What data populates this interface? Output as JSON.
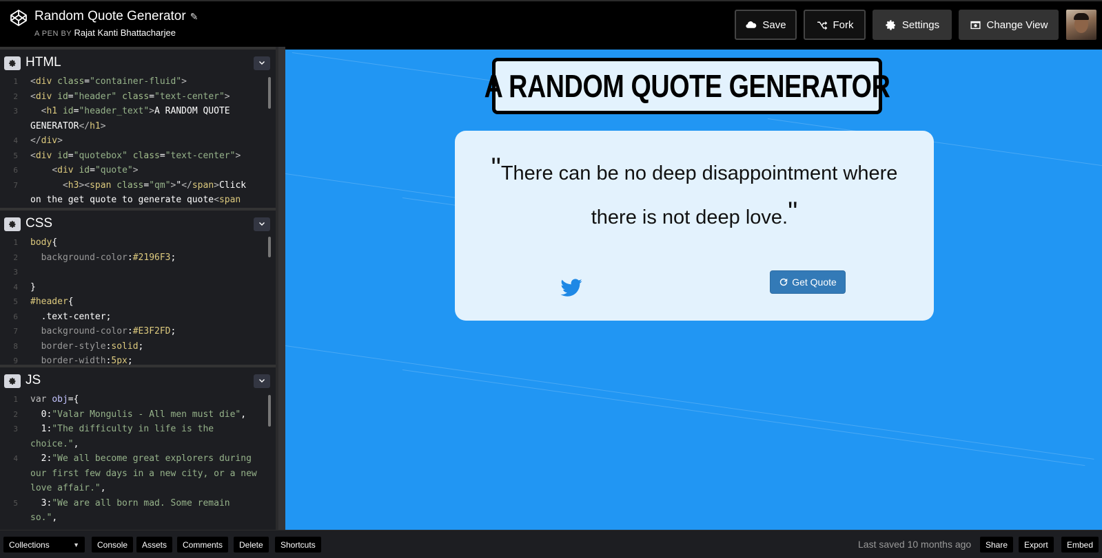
{
  "app": {
    "title": "Random Quote Generator",
    "byline_prefix": "A PEN BY",
    "author": "Rajat Kanti Bhattacharjee"
  },
  "toolbar": {
    "save": "Save",
    "fork": "Fork",
    "settings": "Settings",
    "change_view": "Change View"
  },
  "editors": {
    "html": {
      "name": "HTML",
      "lines": [
        {
          "n": "1",
          "html": "<span class='tok-fade'>&lt;</span><span class='tok-tag'>div</span> <span class='tok-attr'>class</span>=<span class='tok-str'>\"container-fluid\"</span><span class='tok-fade'>&gt;</span>"
        },
        {
          "n": "2",
          "html": "<span class='tok-fade'>&lt;</span><span class='tok-tag'>div</span> <span class='tok-attr'>id</span>=<span class='tok-str'>\"header\"</span> <span class='tok-attr'>class</span>=<span class='tok-str'>\"text-center\"</span><span class='tok-fade'>&gt;</span>"
        },
        {
          "n": "3",
          "html": "  <span class='tok-fade'>&lt;</span><span class='tok-tag'>h1</span> <span class='tok-attr'>id</span>=<span class='tok-str'>\"header_text\"</span><span class='tok-fade'>&gt;</span>A RANDOM QUOTE GENERATOR<span class='tok-fade'>&lt;/</span><span class='tok-tag'>h1</span><span class='tok-fade'>&gt;</span>"
        },
        {
          "n": "4",
          "html": "<span class='tok-fade'>&lt;/</span><span class='tok-tag'>div</span><span class='tok-fade'>&gt;</span>"
        },
        {
          "n": "5",
          "html": "<span class='tok-fade'>&lt;</span><span class='tok-tag'>div</span> <span class='tok-attr'>id</span>=<span class='tok-str'>\"quotebox\"</span> <span class='tok-attr'>class</span>=<span class='tok-str'>\"text-center\"</span><span class='tok-fade'>&gt;</span>"
        },
        {
          "n": "6",
          "html": "    <span class='tok-fade'>&lt;</span><span class='tok-tag'>div</span> <span class='tok-attr'>id</span>=<span class='tok-str'>\"quote\"</span><span class='tok-fade'>&gt;</span>"
        },
        {
          "n": "7",
          "html": "      <span class='tok-fade'>&lt;</span><span class='tok-tag'>h3</span><span class='tok-fade'>&gt;&lt;</span><span class='tok-tag'>span</span> <span class='tok-attr'>class</span>=<span class='tok-str'>\"qm\"</span><span class='tok-fade'>&gt;</span>\"<span class='tok-fade'>&lt;/</span><span class='tok-tag'>span</span><span class='tok-fade'>&gt;</span>Click on the get quote to generate quote<span class='tok-fade'>&lt;</span><span class='tok-tag'>span</span>"
        }
      ]
    },
    "css": {
      "name": "CSS",
      "lines": [
        {
          "n": "1",
          "html": "<span class='tok-sel'>body</span>{"
        },
        {
          "n": "2",
          "html": "  <span class='tok-prop'>background-color</span>:<span class='tok-num'>#2196F3</span>;"
        },
        {
          "n": "3",
          "html": " "
        },
        {
          "n": "4",
          "html": "}"
        },
        {
          "n": "5",
          "html": "<span class='tok-sel'>#header</span>{"
        },
        {
          "n": "6",
          "html": "  .text-center;"
        },
        {
          "n": "7",
          "html": "  <span class='tok-prop'>background-color</span>:<span class='tok-num'>#E3F2FD</span>;"
        },
        {
          "n": "8",
          "html": "  <span class='tok-prop'>border-style</span>:<span class='tok-num'>solid</span>;"
        },
        {
          "n": "9",
          "html": "  <span class='tok-prop'>border-width</span>:<span class='tok-num'>5px</span>;"
        }
      ]
    },
    "js": {
      "name": "JS",
      "lines": [
        {
          "n": "1",
          "html": "<span class='tok-kw'>var</span> <span class='tok-tag' style='color:#c4c4ff'>obj</span>={"
        },
        {
          "n": "2",
          "html": "  0:<span class='tok-str'>\"Valar Mongulis - All men must die\"</span>,"
        },
        {
          "n": "3",
          "html": "  1:<span class='tok-str'>\"The difficulty in life is the choice.\"</span>,"
        },
        {
          "n": "4",
          "html": "  2:<span class='tok-str'>\"We all become great explorers during our first few days in a new city, or a new love affair.\"</span>,"
        },
        {
          "n": "5",
          "html": "  3:<span class='tok-str'>\"We are all born mad. Some remain so.\"</span>,"
        }
      ]
    }
  },
  "preview": {
    "header_text": "A RANDOM QUOTE GENERATOR",
    "quote_text": "There can be no deep disappointment where there is not deep love.",
    "quote_mark": "\"",
    "get_quote_label": "Get Quote",
    "background": "#2196F3",
    "box_color": "#E3F2FD",
    "twitter_color": "#1E88E5"
  },
  "bottombar": {
    "collections": "Collections",
    "console": "Console",
    "assets": "Assets",
    "comments": "Comments",
    "delete": "Delete",
    "shortcuts": "Shortcuts",
    "last_saved": "Last saved 10 months ago",
    "share": "Share",
    "export": "Export",
    "embed": "Embed"
  }
}
